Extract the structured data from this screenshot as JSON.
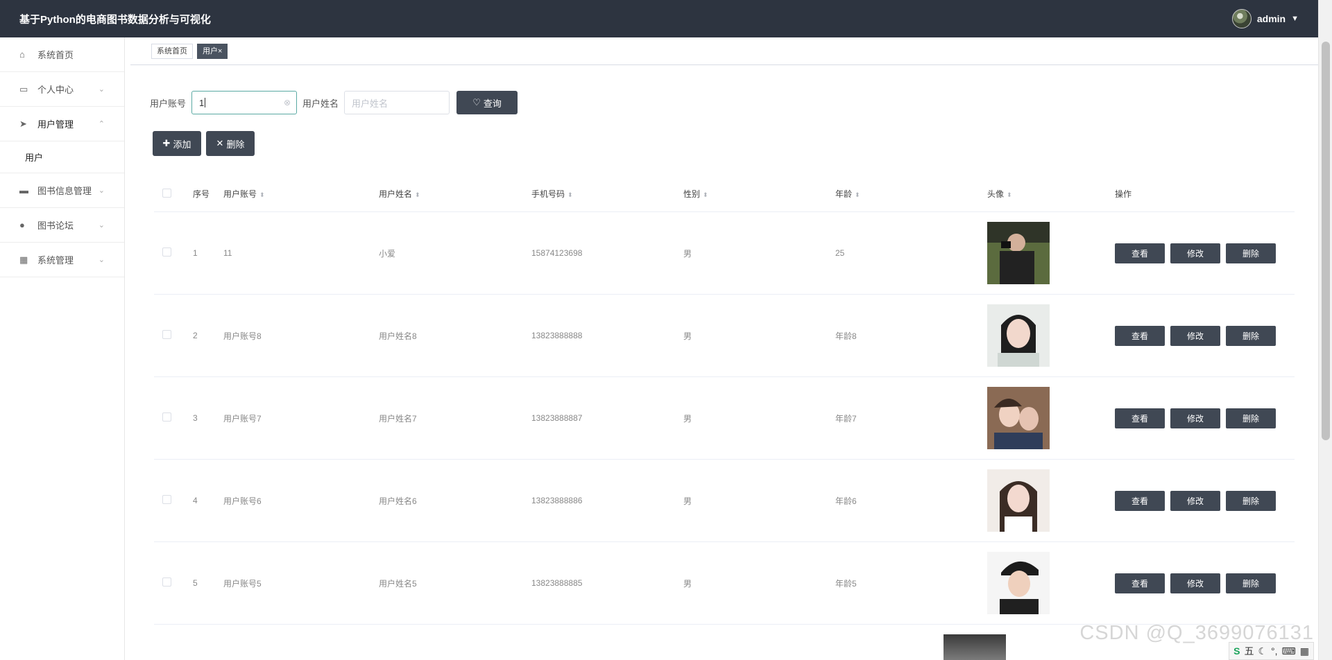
{
  "header": {
    "title": "基于Python的电商图书数据分析与可视化",
    "user": "admin"
  },
  "sidebar": {
    "items": [
      {
        "label": "系统首页",
        "icon": "home-icon"
      },
      {
        "label": "个人中心",
        "icon": "card-icon"
      },
      {
        "label": "用户管理",
        "icon": "send-icon"
      },
      {
        "label": "图书信息管理",
        "icon": "monitor-icon"
      },
      {
        "label": "图书论坛",
        "icon": "person-icon"
      },
      {
        "label": "系统管理",
        "icon": "grid-icon"
      }
    ],
    "submenu": {
      "label": "用户"
    }
  },
  "tabs": [
    {
      "label": "系统首页"
    },
    {
      "label": "用户"
    }
  ],
  "search": {
    "account_label": "用户账号",
    "account_value": "1",
    "name_label": "用户姓名",
    "name_placeholder": "用户姓名",
    "search_button": "查询"
  },
  "actions": {
    "add": "添加",
    "delete": "删除"
  },
  "table": {
    "columns": [
      "序号",
      "用户账号",
      "用户姓名",
      "手机号码",
      "性别",
      "年龄",
      "头像",
      "操作"
    ],
    "ops": {
      "view": "查看",
      "edit": "修改",
      "delete": "删除"
    },
    "rows": [
      {
        "idx": "1",
        "account": "11",
        "name": "小爱",
        "phone": "15874123698",
        "sex": "男",
        "age": "25"
      },
      {
        "idx": "2",
        "account": "用户账号8",
        "name": "用户姓名8",
        "phone": "13823888888",
        "sex": "男",
        "age": "年龄8"
      },
      {
        "idx": "3",
        "account": "用户账号7",
        "name": "用户姓名7",
        "phone": "13823888887",
        "sex": "男",
        "age": "年龄7"
      },
      {
        "idx": "4",
        "account": "用户账号6",
        "name": "用户姓名6",
        "phone": "13823888886",
        "sex": "男",
        "age": "年龄6"
      },
      {
        "idx": "5",
        "account": "用户账号5",
        "name": "用户姓名5",
        "phone": "13823888885",
        "sex": "男",
        "age": "年龄5"
      }
    ]
  },
  "watermark": "CSDN @Q_3699076131",
  "ime": {
    "label": "五"
  }
}
